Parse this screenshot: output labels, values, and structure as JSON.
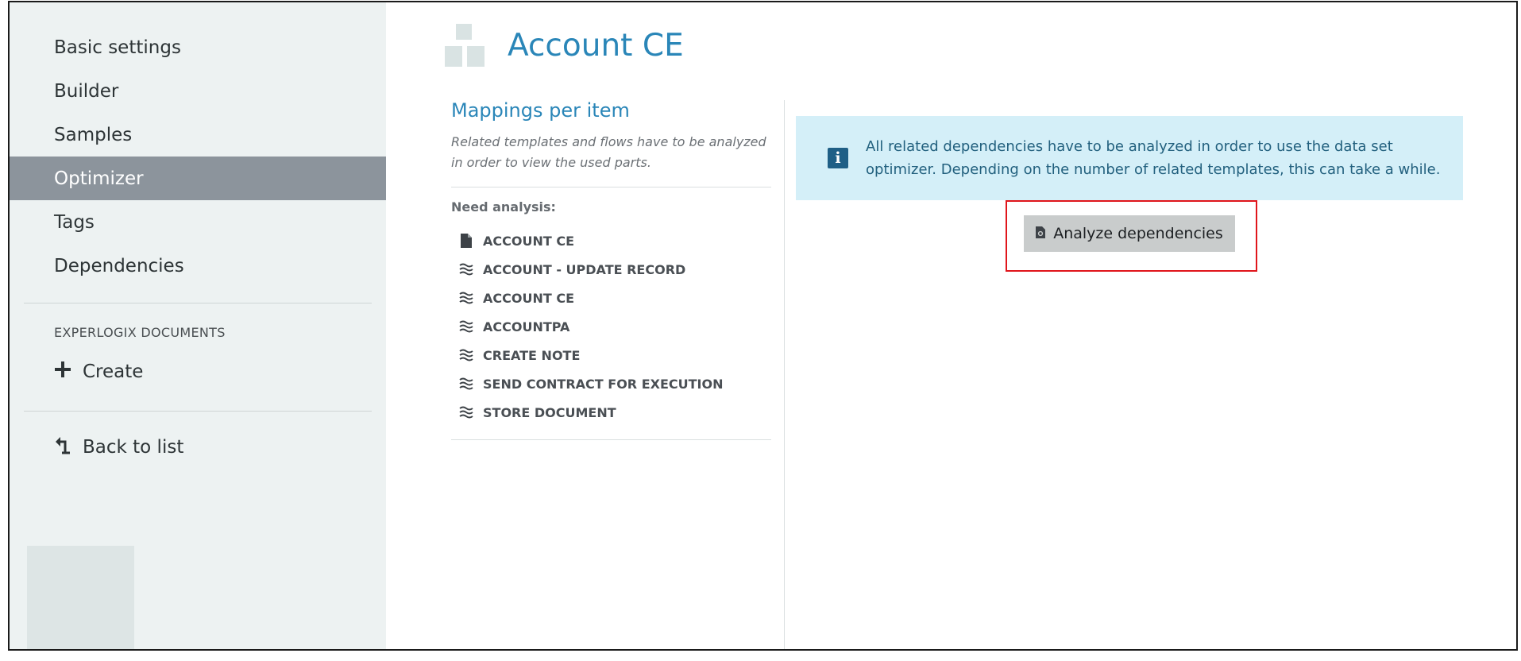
{
  "sidebar": {
    "items": [
      {
        "label": "Basic settings"
      },
      {
        "label": "Builder"
      },
      {
        "label": "Samples"
      },
      {
        "label": "Optimizer",
        "active": true
      },
      {
        "label": "Tags"
      },
      {
        "label": "Dependencies"
      }
    ],
    "section_label": "EXPERLOGIX DOCUMENTS",
    "create_label": "Create",
    "back_label": "Back to list"
  },
  "header": {
    "title": "Account CE",
    "logo_icon": "blocks-icon"
  },
  "mappings": {
    "title": "Mappings per item",
    "description": "Related templates and flows have to be analyzed in order to view the used parts.",
    "need_analysis_label": "Need analysis:",
    "items": [
      {
        "label": "ACCOUNT CE",
        "icon": "document-icon"
      },
      {
        "label": "ACCOUNT - UPDATE RECORD",
        "icon": "flow-icon"
      },
      {
        "label": "ACCOUNT CE",
        "icon": "flow-icon"
      },
      {
        "label": "ACCOUNTPA",
        "icon": "flow-icon"
      },
      {
        "label": "CREATE NOTE",
        "icon": "flow-icon"
      },
      {
        "label": "SEND CONTRACT FOR EXECUTION",
        "icon": "flow-icon"
      },
      {
        "label": "STORE DOCUMENT",
        "icon": "flow-icon"
      }
    ]
  },
  "info": {
    "message": "All related dependencies have to be analyzed in order to use the data set optimizer. Depending on the number of related templates, this can take a while.",
    "icon": "info-icon",
    "color": "#d4eff8"
  },
  "analyze": {
    "label": "Analyze dependencies",
    "icon": "analyze-file-icon"
  },
  "colors": {
    "accent": "#2a86b8",
    "sidebar_bg": "#edf2f2",
    "active_bg": "#8c949c",
    "highlight": "#e0151b"
  }
}
